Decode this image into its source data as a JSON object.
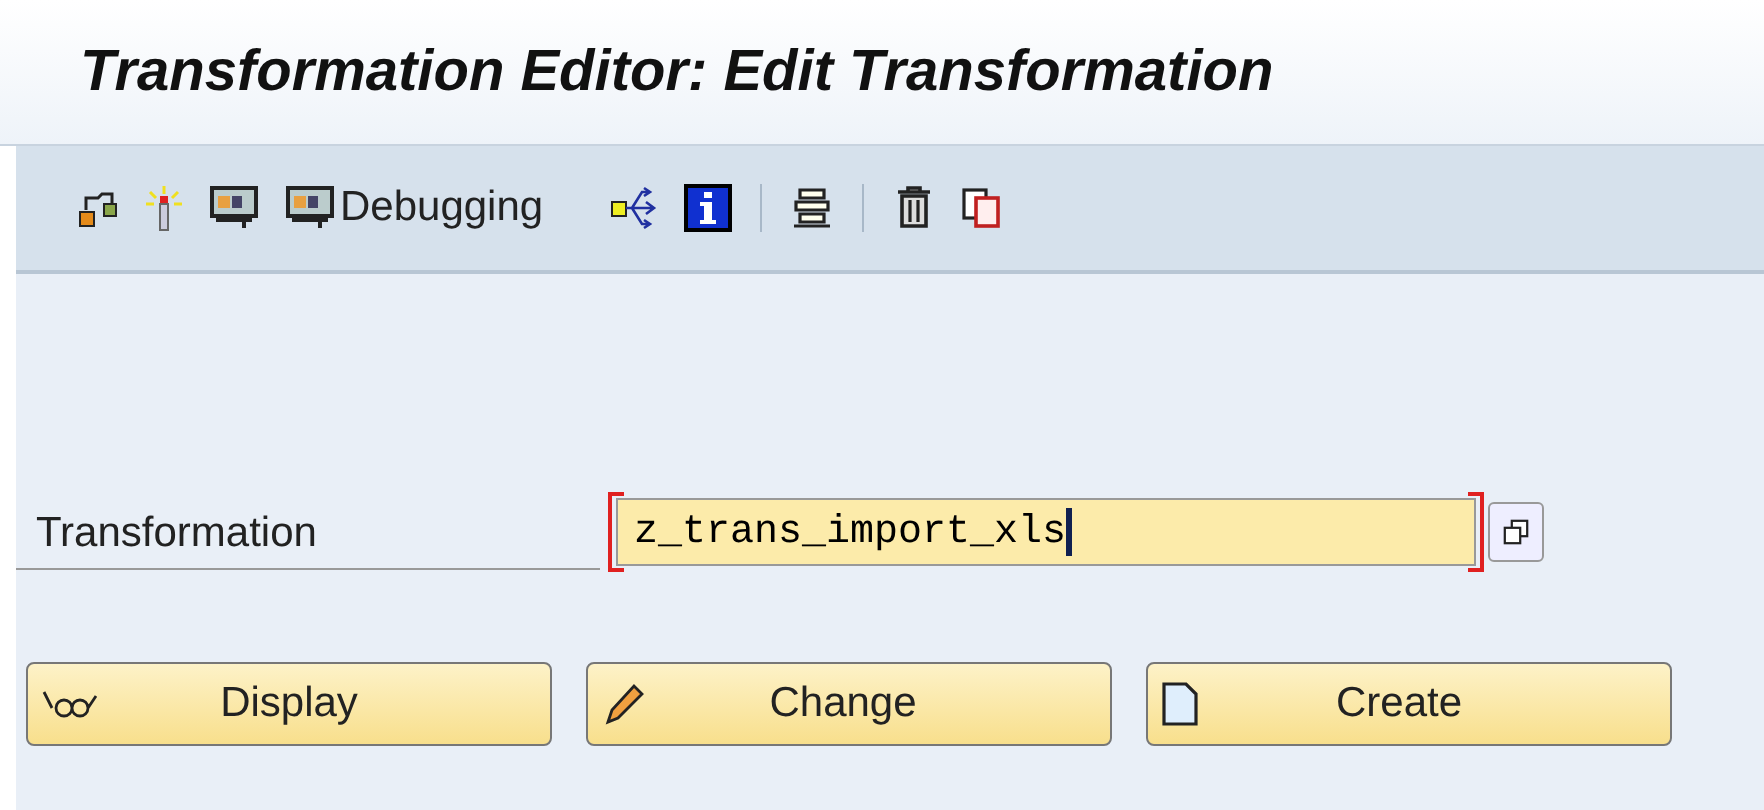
{
  "window": {
    "title": "Transformation Editor: Edit Transformation"
  },
  "toolbar": {
    "debug_button": {
      "label": "Debugging"
    }
  },
  "field": {
    "label": "Transformation",
    "value": "z_trans_import_xls"
  },
  "buttons": [
    {
      "kind": "display",
      "label": "Display"
    },
    {
      "kind": "change",
      "label": "Change"
    },
    {
      "kind": "create",
      "label": "Create"
    }
  ]
}
